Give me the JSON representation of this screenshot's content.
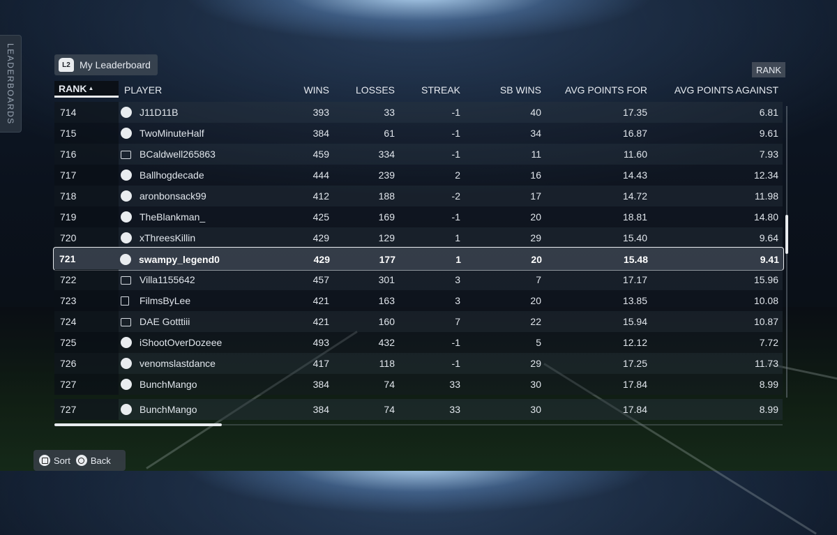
{
  "side_tab": {
    "label": "LEADERBOARDS"
  },
  "my_leaderboard": {
    "badge": "L2",
    "label": "My Leaderboard"
  },
  "sort_tag": "RANK",
  "columns": {
    "rank": "RANK",
    "player": "PLAYER",
    "wins": "WINS",
    "losses": "LOSSES",
    "streak": "STREAK",
    "sb_wins": "SB WINS",
    "avg_for": "AVG POINTS FOR",
    "avg_against": "AVG POINTS AGAINST"
  },
  "sort_arrow": "▲",
  "rows": [
    {
      "rank": "714",
      "platform": "ps",
      "player": "J11D11B",
      "wins": "393",
      "losses": "33",
      "streak": "-1",
      "sb_wins": "40",
      "avg_for": "17.35",
      "avg_against": "6.81"
    },
    {
      "rank": "715",
      "platform": "ps",
      "player": "TwoMinuteHalf",
      "wins": "384",
      "losses": "61",
      "streak": "-1",
      "sb_wins": "34",
      "avg_for": "16.87",
      "avg_against": "9.61"
    },
    {
      "rank": "716",
      "platform": "xbox",
      "player": "BCaldwell265863",
      "wins": "459",
      "losses": "334",
      "streak": "-1",
      "sb_wins": "11",
      "avg_for": "11.60",
      "avg_against": "7.93"
    },
    {
      "rank": "717",
      "platform": "ps",
      "player": "Ballhogdecade",
      "wins": "444",
      "losses": "239",
      "streak": "2",
      "sb_wins": "16",
      "avg_for": "14.43",
      "avg_against": "12.34"
    },
    {
      "rank": "718",
      "platform": "ps",
      "player": "aronbonsack99",
      "wins": "412",
      "losses": "188",
      "streak": "-2",
      "sb_wins": "17",
      "avg_for": "14.72",
      "avg_against": "11.98"
    },
    {
      "rank": "719",
      "platform": "ps",
      "player": "TheBlankman_",
      "wins": "425",
      "losses": "169",
      "streak": "-1",
      "sb_wins": "20",
      "avg_for": "18.81",
      "avg_against": "14.80"
    },
    {
      "rank": "720",
      "platform": "ps",
      "player": "xThreesKillin",
      "wins": "429",
      "losses": "129",
      "streak": "1",
      "sb_wins": "29",
      "avg_for": "15.40",
      "avg_against": "9.64"
    },
    {
      "rank": "721",
      "platform": "ps",
      "player": "swampy_legend0",
      "wins": "429",
      "losses": "177",
      "streak": "1",
      "sb_wins": "20",
      "avg_for": "15.48",
      "avg_against": "9.41",
      "selected": true
    },
    {
      "rank": "722",
      "platform": "xbox",
      "player": "Villa1155642",
      "wins": "457",
      "losses": "301",
      "streak": "3",
      "sb_wins": "7",
      "avg_for": "17.17",
      "avg_against": "15.96"
    },
    {
      "rank": "723",
      "platform": "pc",
      "player": "FilmsByLee",
      "wins": "421",
      "losses": "163",
      "streak": "3",
      "sb_wins": "20",
      "avg_for": "13.85",
      "avg_against": "10.08"
    },
    {
      "rank": "724",
      "platform": "xbox",
      "player": "DAE Gotttiii",
      "wins": "421",
      "losses": "160",
      "streak": "7",
      "sb_wins": "22",
      "avg_for": "15.94",
      "avg_against": "10.87"
    },
    {
      "rank": "725",
      "platform": "ps",
      "player": "iShootOverDozeee",
      "wins": "493",
      "losses": "432",
      "streak": "-1",
      "sb_wins": "5",
      "avg_for": "12.12",
      "avg_against": "7.72"
    },
    {
      "rank": "726",
      "platform": "ps",
      "player": "venomslastdance",
      "wins": "417",
      "losses": "118",
      "streak": "-1",
      "sb_wins": "29",
      "avg_for": "17.25",
      "avg_against": "11.73"
    },
    {
      "rank": "727",
      "platform": "ps",
      "player": "BunchMango",
      "wins": "384",
      "losses": "74",
      "streak": "33",
      "sb_wins": "30",
      "avg_for": "17.84",
      "avg_against": "8.99"
    },
    {
      "rank": "727",
      "platform": "ps",
      "player": "BunchMango",
      "wins": "384",
      "losses": "74",
      "streak": "33",
      "sb_wins": "30",
      "avg_for": "17.84",
      "avg_against": "8.99"
    }
  ],
  "footer": {
    "sort_label": "Sort",
    "back_label": "Back",
    "sort_icon": "square-button-icon",
    "back_icon": "circle-button-icon"
  }
}
